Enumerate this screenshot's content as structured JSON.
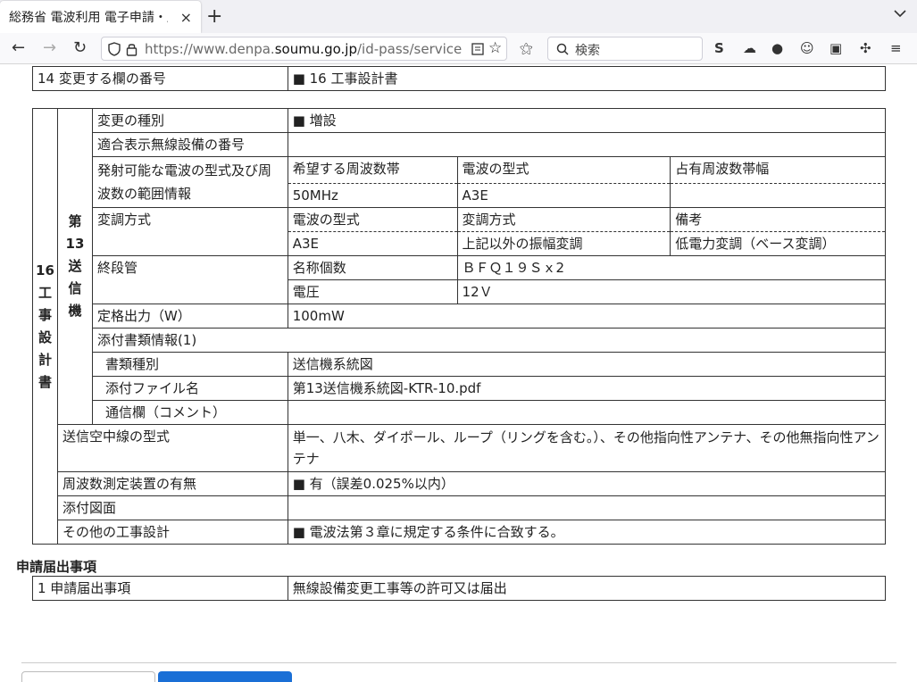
{
  "browser": {
    "tab_title": "総務省 電波利用 電子申請・届",
    "tab_close": "×",
    "new_tab": "+",
    "url_prefix": "https://www.denpa.",
    "url_domain": "soumu.go.jp",
    "url_suffix": "/id-pass/service",
    "search_placeholder": "検索"
  },
  "row14": {
    "label": "14 変更する欄の番号",
    "value": "■ 16 工事設計書"
  },
  "design": {
    "outer_label": "16\n工\n事\n設\n計\n書",
    "inner_label": "第\n13\n送\n信\n機",
    "change_type_label": "変更の種別",
    "change_type_value": "■ 増設",
    "conformity_label": "適合表示無線設備の番号",
    "conformity_value": "",
    "emission_label": "発射可能な電波の型式及び周波数の範囲情報",
    "emission_head": [
      "希望する周波数帯",
      "電波の型式",
      "占有周波数帯幅"
    ],
    "emission_vals": [
      "50MHz",
      "A3E",
      ""
    ],
    "modulation_label": "変調方式",
    "modulation_head": [
      "電波の型式",
      "変調方式",
      "備考"
    ],
    "modulation_vals": [
      "A3E",
      "上記以外の振幅変調",
      "低電力変調（ベース変調）"
    ],
    "final_stage_label": "終段管",
    "name_count_label": "名称個数",
    "name_count_value": "ＢＦＱ１９Ｓｘ2",
    "voltage_label": "電圧",
    "voltage_value": "12Ｖ",
    "rated_output_label": "定格出力（W）",
    "rated_output_value": "100mW",
    "attachment_info_label": "添付書類情報(1)",
    "doc_type_label": "書類種別",
    "doc_type_value": "送信機系統図",
    "file_name_label": "添付ファイル名",
    "file_name_value": "第13送信機系統図-KTR-10.pdf",
    "comment_label": "通信欄（コメント）",
    "comment_value": "",
    "antenna_label": "送信空中線の型式",
    "antenna_value": "単一、八木、ダイポール、ループ（リングを含む。）、その他指向性アンテナ、その他無指向性アンテナ",
    "freq_meter_label": "周波数測定装置の有無",
    "freq_meter_value": "■ 有（誤差0.025%以内）",
    "drawing_label": "添付図面",
    "drawing_value": "",
    "other_label": "その他の工事設計",
    "other_value": "■ 電波法第３章に規定する条件に合致する。"
  },
  "application": {
    "section_title": "申請届出事項",
    "row_label": "1 申請届出事項",
    "row_value": "無線設備変更工事等の許可又は届出"
  }
}
